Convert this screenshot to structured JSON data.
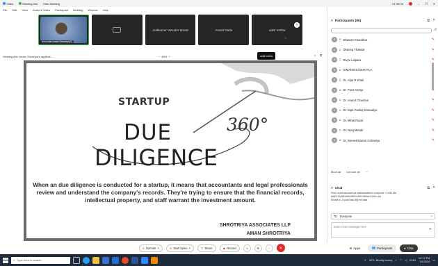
{
  "window": {
    "title_items": [
      "Video",
      "Meeting info",
      "Hide Meeting"
    ],
    "timer": "01:06:08",
    "controls": [
      "–",
      "❐",
      "✕"
    ]
  },
  "menubar": [
    "File",
    "Edit",
    "View",
    "Audio & Video",
    "Participant",
    "Meeting",
    "Window",
    "Help"
  ],
  "thumbnails": [
    {
      "name": "Advocate Aman Shrotriya(C)",
      "kind": "video"
    },
    {
      "name": "",
      "kind": "camera-off"
    },
    {
      "name": "Anitkumar Vasudev Bavat",
      "kind": "name"
    },
    {
      "name": "Anand Sadu",
      "kind": "name"
    },
    {
      "name": "ankit mehta",
      "kind": "name"
    }
  ],
  "viewbar": {
    "label": "Viewing Adv. Aman Shrotriya's applicat...",
    "zoom": "49%",
    "speaker": "ankit mehta"
  },
  "slide": {
    "startup": "STARTUP",
    "due": "DUE",
    "diligence": "DILIGENCE",
    "degree": "360°",
    "body": "When an due diligence is conducted for a startup, it means that accountants and legal professionals review and understand the company's records. They're trying to ensure that the financial records, intellectual property, and staff warrant the investment amount.",
    "firm": "SHROTRIYA ASSOCIATES LLP",
    "author": "AMAN SHROTRIYA"
  },
  "toolbar": {
    "unmute": "Unmute",
    "start_video": "Start video",
    "share": "Share",
    "record": "Record",
    "apps": "Apps",
    "participants": "Participants",
    "chat": "Chat"
  },
  "participants_panel": {
    "title": "Participants (85)",
    "members": [
      {
        "initial": "D",
        "name": "Dhawan Khandhar"
      },
      {
        "initial": "D",
        "name": "Dhanraj Thakkar"
      },
      {
        "initial": "D",
        "name": "Divya Lalpara"
      },
      {
        "initial": "D",
        "name": "DIMANSHU BHATALA"
      },
      {
        "initial": "D",
        "name": "Dr. Alpa R Shah"
      },
      {
        "initial": "D",
        "name": "Dr. Punit Vamja"
      },
      {
        "initial": "D",
        "name": "Dr. Anand Chauhan"
      },
      {
        "initial": "D",
        "name": "Dr. Dipti Pankaj Domadiya"
      },
      {
        "initial": "D",
        "name": "Dr. Mihal Raval"
      },
      {
        "initial": "D",
        "name": "Dr. Niraj Mandir"
      },
      {
        "initial": "D",
        "name": "Dr. Rameshkumar Gohaniya"
      }
    ],
    "more_all": "More all",
    "unmute_all": "Unmute all"
  },
  "chat_panel": {
    "title": "Chat",
    "messages": [
      "From mukti ahuwani ya mahamadani to everyone :  11:52 AM",
      "MADI KUANVAKINIEN ASIN MINAHI DALLAU",
      "Shrest is...it point law dig me data"
    ],
    "to_label": "To:",
    "to_value": "Everyone",
    "placeholder": "Enter chat message here"
  },
  "taskbar": {
    "search_placeholder": "Type here to search",
    "weather": "32°C  Mostly sunny",
    "lang": "ENG",
    "time": "12:17 PM",
    "date": "3/1/2024"
  },
  "colors": {
    "accent": "#2d8cff",
    "danger": "#e02828",
    "active_speaker": "#2fb84a",
    "taskbar": "#1f2a3a"
  }
}
